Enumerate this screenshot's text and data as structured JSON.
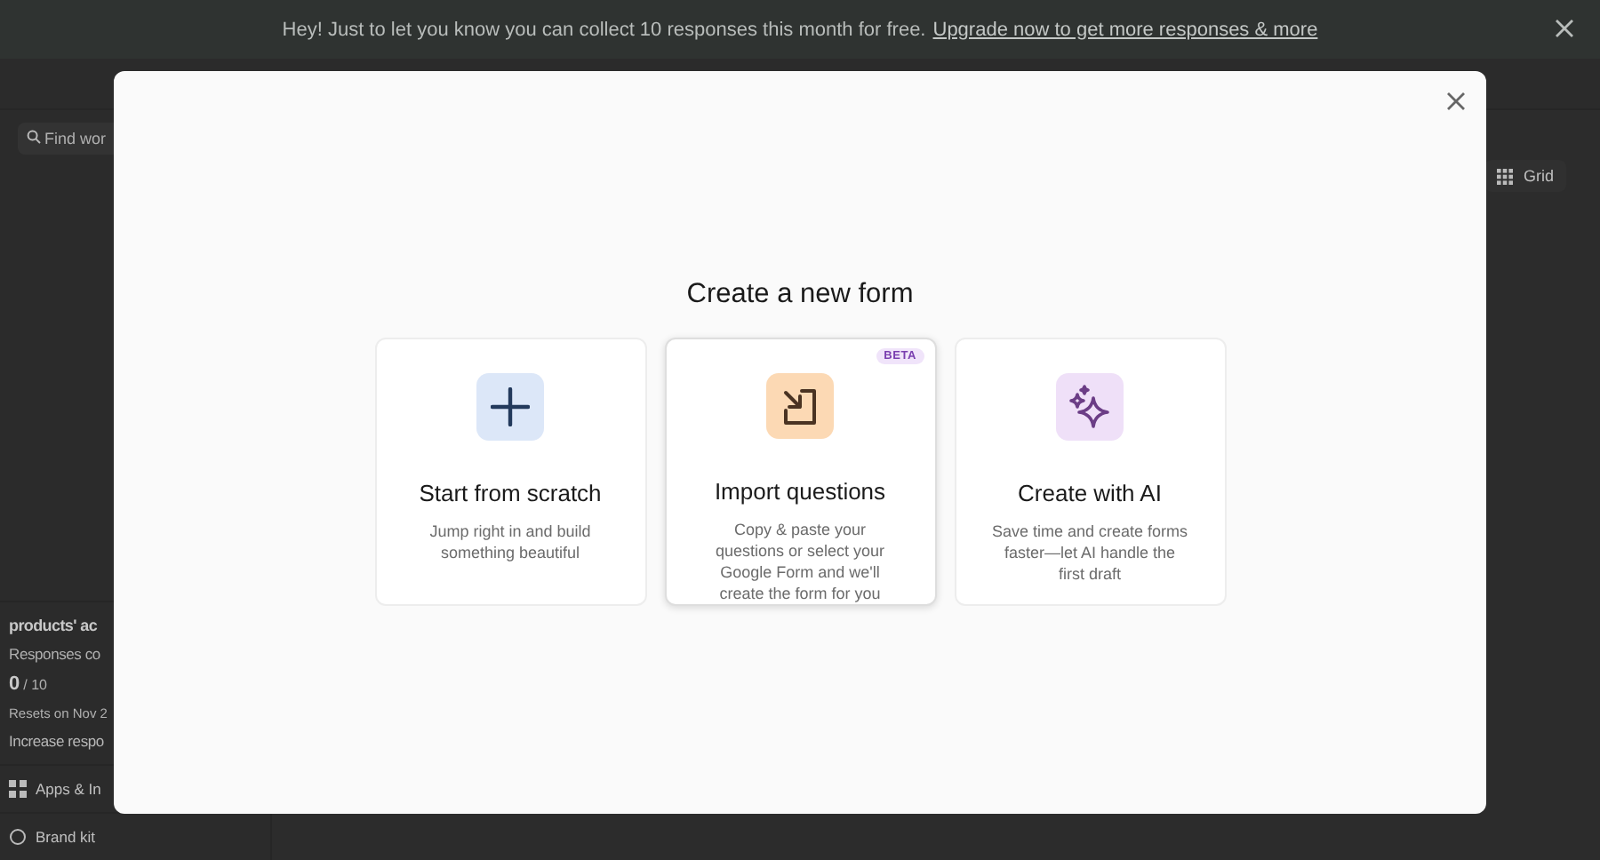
{
  "banner": {
    "message": "Hey! Just to let you know you can collect 10 responses this month for free.",
    "link": "Upgrade now to get more responses & more"
  },
  "search": {
    "placeholder": "Find wor"
  },
  "view_toggle": {
    "label": "Grid"
  },
  "sidebar": {
    "workspace_title": "products' ac",
    "responses_label": "Responses co",
    "count": "0",
    "limit": "/ 10",
    "resets": "Resets on Nov 2",
    "increase_link": "Increase respo",
    "items": [
      {
        "label": "Apps & In",
        "kind": "apps"
      },
      {
        "label": "Brand kit",
        "kind": "brand"
      }
    ]
  },
  "modal": {
    "title": "Create a new form",
    "options": [
      {
        "kind": "scratch",
        "title": "Start from scratch",
        "description": "Jump right in and build something beautiful",
        "selected": false
      },
      {
        "kind": "import",
        "title": "Import questions",
        "description": "Copy & paste your questions or select your Google Form and we'll create the form for you",
        "badge": "BETA",
        "selected": true
      },
      {
        "kind": "ai",
        "title": "Create with AI",
        "description": "Save time and create forms faster—let AI handle the first draft",
        "selected": false
      }
    ]
  }
}
